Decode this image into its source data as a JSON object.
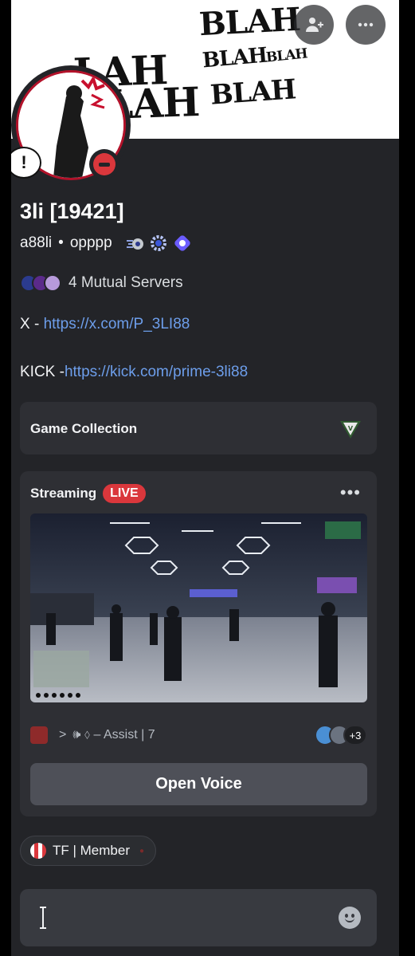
{
  "banner": {
    "text_1": "BLAH",
    "text_2": "BLAH",
    "text_3": "BLAH",
    "text_4": "BLAH",
    "text_5": "LAH",
    "text_6": "BLAH",
    "add_friend_icon": "add-friend-icon",
    "more_icon": "more-icon"
  },
  "avatar": {
    "status": "do-not-disturb",
    "bubble_text": "!"
  },
  "profile": {
    "display_name": "3li [19421]",
    "username": "a88li",
    "separator": "•",
    "pronouns": "opppp",
    "badges": [
      "nitro-badge",
      "boost-badge",
      "quest-badge"
    ]
  },
  "mutual": {
    "label": "4 Mutual Servers"
  },
  "bio": {
    "x_prefix": "X - ",
    "x_link": "https://x.com/P_3LI88",
    "kick_prefix": "KICK -",
    "kick_link": "https://kick.com/prime-3li88"
  },
  "game_collection": {
    "title": "Game Collection",
    "icon": "gta-v-icon"
  },
  "stream": {
    "title": "Streaming",
    "live_label": "LIVE",
    "more_label": "•••",
    "channel_chevron": ">",
    "channel_name": "🕪 ⬨ – Assist | 7",
    "participant_extra": "+3",
    "open_voice_label": "Open Voice"
  },
  "role": {
    "label": "TF | Member",
    "dot": "●"
  },
  "message": {
    "emoji_icon": "emoji-icon"
  },
  "colors": {
    "background": "#232428",
    "card": "#2e2f34",
    "link": "#6d9eeb",
    "live": "#da373c",
    "button": "#4e5058"
  }
}
